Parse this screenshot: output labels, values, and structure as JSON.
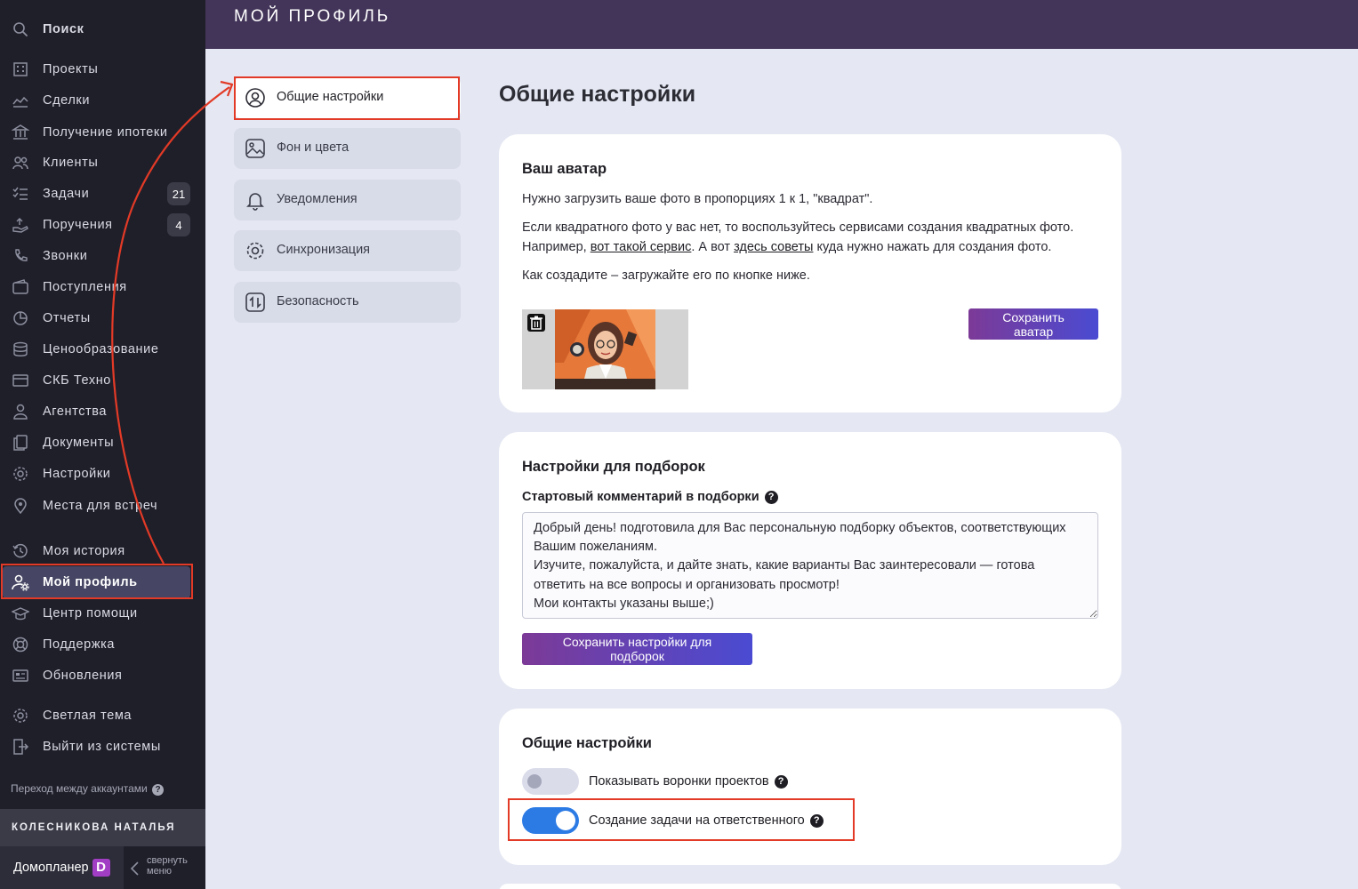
{
  "sidebar": {
    "search_label": "Поиск",
    "items": [
      {
        "label": "Проекты",
        "icon": "building-icon"
      },
      {
        "label": "Сделки",
        "icon": "handshake-icon"
      },
      {
        "label": "Получение ипотеки",
        "icon": "bank-icon"
      },
      {
        "label": "Клиенты",
        "icon": "users-icon"
      },
      {
        "label": "Задачи",
        "icon": "tasks-icon",
        "badge": "21"
      },
      {
        "label": "Поручения",
        "icon": "hand-icon",
        "badge": "4"
      },
      {
        "label": "Звонки",
        "icon": "phone-icon"
      },
      {
        "label": "Поступления",
        "icon": "wallet-icon"
      },
      {
        "label": "Отчеты",
        "icon": "chart-icon"
      },
      {
        "label": "Ценообразование",
        "icon": "coins-icon"
      },
      {
        "label": "СКБ Техно",
        "icon": "window-icon"
      },
      {
        "label": "Агентства",
        "icon": "agent-icon"
      },
      {
        "label": "Документы",
        "icon": "documents-icon"
      },
      {
        "label": "Настройки",
        "icon": "gear-icon"
      },
      {
        "label": "Места для встреч",
        "icon": "pin-icon"
      },
      {
        "label": "Моя история",
        "icon": "history-icon"
      },
      {
        "label": "Мой профиль",
        "icon": "user-gear-icon",
        "active": true
      },
      {
        "label": "Центр помощи",
        "icon": "graduation-icon"
      },
      {
        "label": "Поддержка",
        "icon": "lifebuoy-icon"
      },
      {
        "label": "Обновления",
        "icon": "news-icon"
      },
      {
        "label": "Светлая тема",
        "icon": "gear-icon"
      },
      {
        "label": "Выйти из системы",
        "icon": "exit-icon"
      }
    ],
    "account_switch": "Переход между аккаунтами",
    "user_name": "КОЛЕСНИКОВА НАТАЛЬЯ",
    "logo_text": "Домопланер",
    "logo_mark": "D",
    "collapse_label": "свернуть меню"
  },
  "header": {
    "title": "МОЙ ПРОФИЛЬ"
  },
  "subnav": [
    {
      "label": "Общие настройки",
      "icon": "user-circle-icon",
      "active": true
    },
    {
      "label": "Фон и цвета",
      "icon": "image-icon"
    },
    {
      "label": "Уведомления",
      "icon": "bell-icon"
    },
    {
      "label": "Синхронизация",
      "icon": "gear-icon"
    },
    {
      "label": "Безопасность",
      "icon": "swap-icon"
    }
  ],
  "main": {
    "title": "Общие настройки",
    "avatar_card": {
      "title": "Ваш аватар",
      "line1": "Нужно загрузить ваше фото в пропорциях 1 к 1, \"квадрат\".",
      "line2": "Если квадратного фото у вас нет, то воспользуйтесь сервисами создания квадратных фото.",
      "line3_a": "Например,",
      "line3_link1": "вот такой сервис",
      "line3_b": ". А вот",
      "line3_link2": "здесь советы",
      "line3_c": "куда нужно нажать для создания фото.",
      "line4": "Как создадите – загружайте его по кнопке ниже.",
      "save_button": "Сохранить аватар"
    },
    "selection_card": {
      "title": "Настройки для подборок",
      "field_label": "Стартовый комментарий в подборки",
      "comment": "Добрый день! подготовила для Вас персональную подборку объектов, соответствующих Вашим пожеланиям.\nИзучите, пожалуйста, и дайте знать, какие варианты Вас заинтересовали — готова ответить на все вопросы и организовать просмотр!\nМои контакты указаны выше;)",
      "save_button": "Сохранить настройки для подборок"
    },
    "general_card": {
      "title": "Общие настройки",
      "toggles": [
        {
          "label": "Показывать воронки проектов",
          "on": false
        },
        {
          "label": "Создание задачи на ответственного",
          "on": true
        }
      ]
    }
  },
  "colors": {
    "sidebar_bg": "#1f1f2a",
    "header_bg": "#433559",
    "accent_button_from": "#7c3a97",
    "accent_button_to": "#4a4bd2",
    "toggle_on": "#2c7be5",
    "highlight_red": "#e23a26"
  }
}
